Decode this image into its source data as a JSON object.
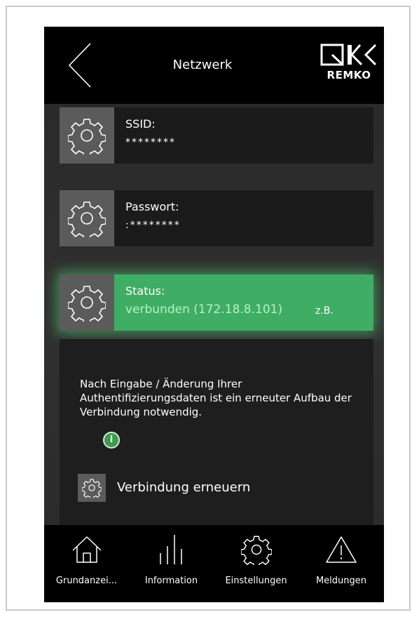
{
  "header": {
    "title": "Netzwerk",
    "logo_text": "REMKO",
    "back_icon": "chevron-left-icon"
  },
  "rows": {
    "ssid": {
      "label": "SSID:",
      "value": "********",
      "icon": "gear-icon"
    },
    "password": {
      "label": "Passwort:",
      "value": ":********",
      "icon": "gear-icon"
    },
    "status": {
      "label": "Status:",
      "value": "verbunden (172.18.8.101)",
      "note": "z.B.",
      "icon": "gear-icon",
      "color": "#3fad64"
    }
  },
  "info": {
    "text": "Nach Eingabe / Änderung Ihrer Authentifizierungsdaten ist ein erneuter Aufbau der Verbindung notwendig.",
    "icon": "info-icon",
    "icon_glyph": "i"
  },
  "renew": {
    "label": "Verbindung erneuern",
    "icon": "gear-icon"
  },
  "nav": [
    {
      "label": "Grundanzei...",
      "icon": "home-icon"
    },
    {
      "label": "Information",
      "icon": "bars-icon"
    },
    {
      "label": "Einstellungen",
      "icon": "gear-icon"
    },
    {
      "label": "Meldungen",
      "icon": "warning-icon"
    }
  ]
}
